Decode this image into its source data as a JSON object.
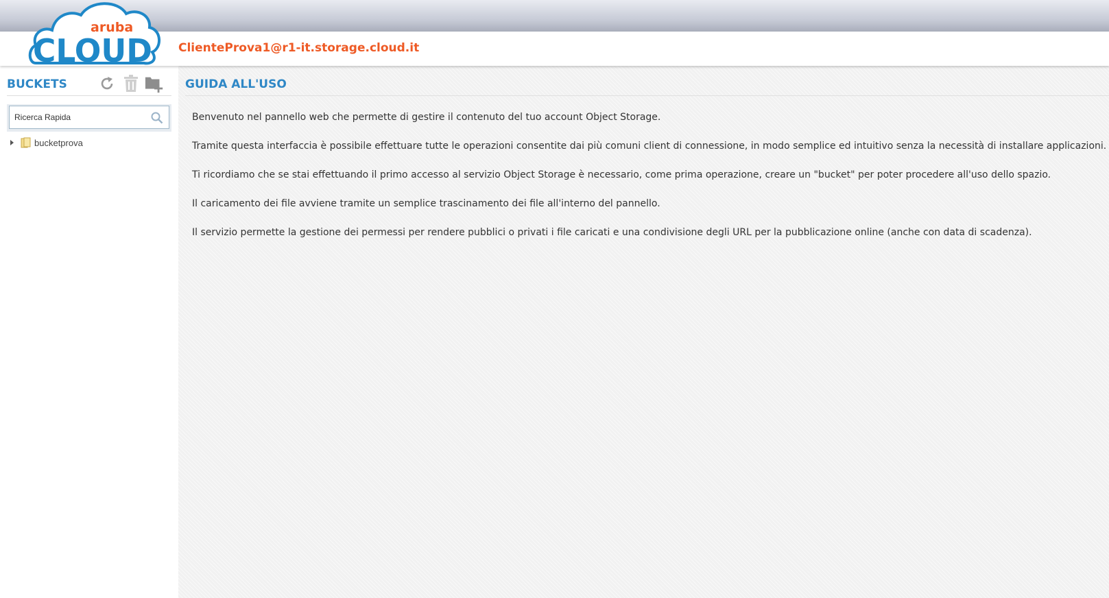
{
  "header": {
    "user_email": "ClienteProva1@r1-it.storage.cloud.it"
  },
  "logo": {
    "brand_small": "aruba",
    "brand_large": "CLOUD",
    "colors": {
      "blue": "#1f88c8",
      "orange": "#ee5a25"
    }
  },
  "sidebar": {
    "title": "BUCKETS",
    "tools": [
      {
        "name": "refresh",
        "icon": "refresh-icon"
      },
      {
        "name": "delete",
        "icon": "trash-icon"
      },
      {
        "name": "add-folder",
        "icon": "folder-add-icon"
      }
    ],
    "search": {
      "placeholder": "Ricerca Rapida",
      "value": ""
    },
    "tree": [
      {
        "label": "bucketprova",
        "icon": "bucket-icon",
        "expanded": false
      }
    ]
  },
  "main": {
    "title": "GUIDA ALL'USO",
    "paragraphs": [
      "Benvenuto nel pannello web che permette di gestire il contenuto del tuo account Object Storage.",
      "Tramite questa interfaccia è possibile effettuare tutte le operazioni consentite dai più comuni client di connessione, in modo semplice ed intuitivo senza la necessità di installare applicazioni.",
      "Ti ricordiamo che se stai effettuando il primo accesso al servizio Object Storage è necessario, come prima operazione, creare un \"bucket\" per poter procedere all'uso dello spazio.",
      "Il caricamento dei file avviene tramite un semplice trascinamento dei file all'interno del pannello.",
      "Il servizio permette la gestione dei permessi per rendere pubblici o privati i file caricati e una condivisione degli URL per la pubblicazione online (anche con data di scadenza)."
    ]
  },
  "colors": {
    "accent_blue": "#2e87c6",
    "email_orange": "#ee5a25",
    "icon_gray": "#9a9a9a"
  }
}
